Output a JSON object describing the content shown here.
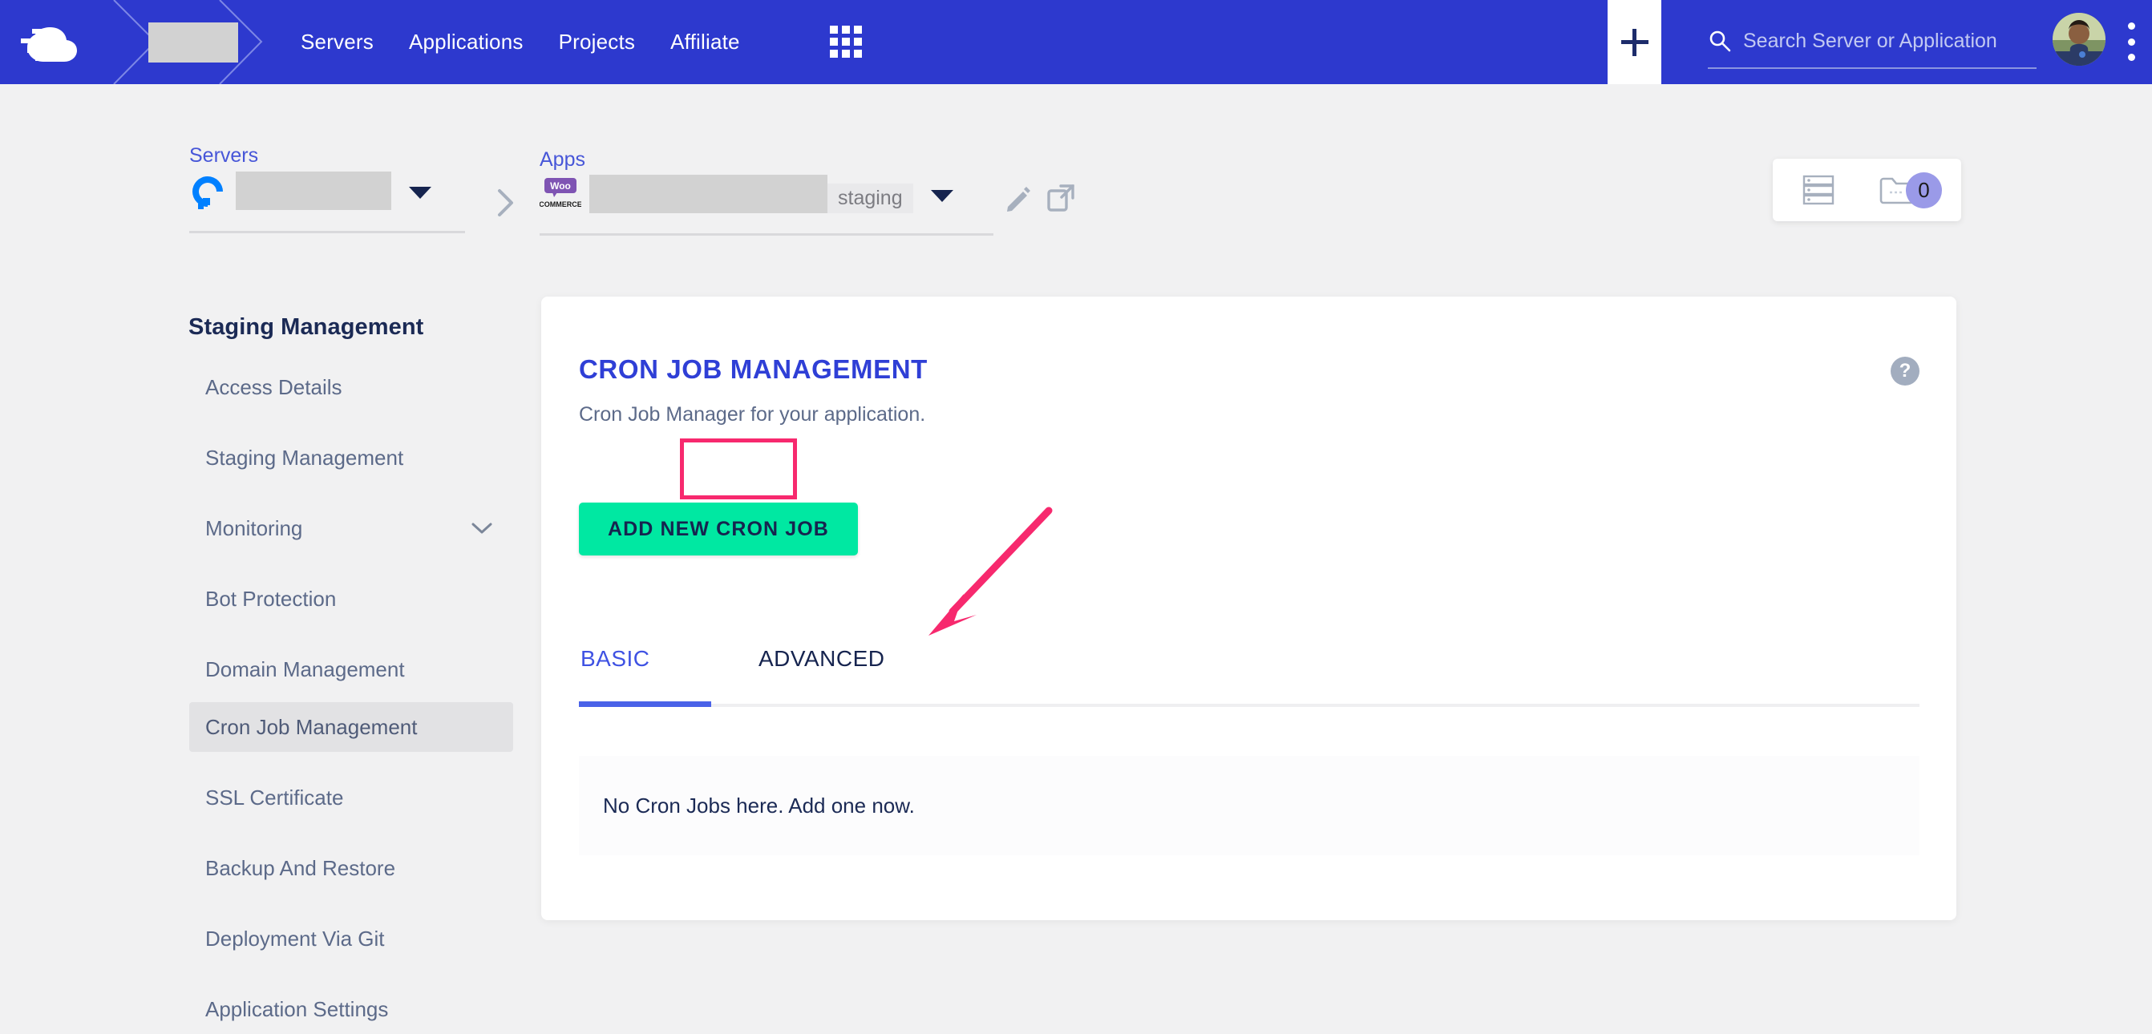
{
  "topnav": {
    "brand_icon": "cloudways-cloud-logo",
    "account_name_redacted": "",
    "links": [
      {
        "label": "Servers",
        "name": "nav-servers"
      },
      {
        "label": "Applications",
        "name": "nav-applications"
      },
      {
        "label": "Projects",
        "name": "nav-projects"
      },
      {
        "label": "Affiliate",
        "name": "nav-affiliate"
      }
    ],
    "grid_icon": "apps-grid-icon",
    "plus_label": "+",
    "search": {
      "placeholder": "Search Server or Application",
      "value": ""
    },
    "avatar": "user-avatar",
    "kebab": "vertical-dots-menu-icon"
  },
  "breadcrumb": {
    "servers_label": "Servers",
    "apps_label": "Apps",
    "server_name_redacted": "",
    "app_name_redacted": "",
    "provider_icon": "digitalocean-icon",
    "app_type_icon": "woocommerce-icon",
    "staging_badge": "staging",
    "separator_icon": "chevron-right-icon",
    "edit_icon": "pencil-edit-icon",
    "launch_icon": "external-link-icon"
  },
  "toolbar": {
    "server_icon": "server-stack-icon",
    "folder_icon": "folder-icon",
    "count_badge": "0"
  },
  "sidebar": {
    "title": "Staging Management",
    "items": [
      {
        "label": "Access Details",
        "active": false,
        "expandable": false
      },
      {
        "label": "Staging Management",
        "active": false,
        "expandable": false
      },
      {
        "label": "Monitoring",
        "active": false,
        "expandable": true
      },
      {
        "label": "Bot Protection",
        "active": false,
        "expandable": false
      },
      {
        "label": "Domain Management",
        "active": false,
        "expandable": false
      },
      {
        "label": "Cron Job Management",
        "active": true,
        "expandable": false
      },
      {
        "label": "SSL Certificate",
        "active": false,
        "expandable": false
      },
      {
        "label": "Backup And Restore",
        "active": false,
        "expandable": false
      },
      {
        "label": "Deployment Via Git",
        "active": false,
        "expandable": false
      },
      {
        "label": "Application Settings",
        "active": false,
        "expandable": false
      }
    ]
  },
  "main": {
    "title": "CRON JOB MANAGEMENT",
    "subtitle": "Cron Job Manager for your application.",
    "help_icon": "?",
    "add_button_label": "ADD NEW CRON JOB",
    "tabs": [
      {
        "label": "BASIC",
        "active": true
      },
      {
        "label": "ADVANCED",
        "active": false,
        "highlighted": true
      }
    ],
    "empty_message": "No Cron Jobs here. Add one now."
  },
  "colors": {
    "brand_blue": "#2d39ce",
    "page_bg": "#f1f1f2",
    "accent_green": "#00e8a2",
    "title_blue": "#2f3fd6",
    "tab_active_blue": "#4a62e8",
    "annotation_pink": "#f7296e",
    "badge_purple": "#9a9ae8",
    "navy_text": "#16244f"
  }
}
